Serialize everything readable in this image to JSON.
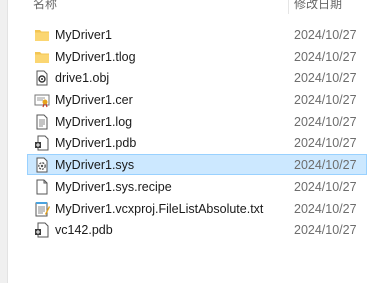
{
  "header": {
    "name_label": "名称",
    "date_label": "修改日期"
  },
  "files": [
    {
      "name": "MyDriver1",
      "date": "2024/10/27",
      "icon": "folder-icon",
      "selected": false
    },
    {
      "name": "MyDriver1.tlog",
      "date": "2024/10/27",
      "icon": "folder-icon",
      "selected": false
    },
    {
      "name": "drive1.obj",
      "date": "2024/10/27",
      "icon": "obj-file-icon",
      "selected": false
    },
    {
      "name": "MyDriver1.cer",
      "date": "2024/10/27",
      "icon": "certificate-file-icon",
      "selected": false
    },
    {
      "name": "MyDriver1.log",
      "date": "2024/10/27",
      "icon": "text-file-icon",
      "selected": false
    },
    {
      "name": "MyDriver1.pdb",
      "date": "2024/10/27",
      "icon": "pdb-file-icon",
      "selected": false
    },
    {
      "name": "MyDriver1.sys",
      "date": "2024/10/27",
      "icon": "system-file-icon",
      "selected": true
    },
    {
      "name": "MyDriver1.sys.recipe",
      "date": "2024/10/27",
      "icon": "blank-file-icon",
      "selected": false
    },
    {
      "name": "MyDriver1.vcxproj.FileListAbsolute.txt",
      "date": "2024/10/27",
      "icon": "notepad-file-icon",
      "selected": false
    },
    {
      "name": "vc142.pdb",
      "date": "2024/10/27",
      "icon": "pdb-file-icon",
      "selected": false
    }
  ],
  "colors": {
    "selection_bg": "#cce8ff",
    "selection_border": "#99d1ff",
    "folder": "#f3c553"
  }
}
